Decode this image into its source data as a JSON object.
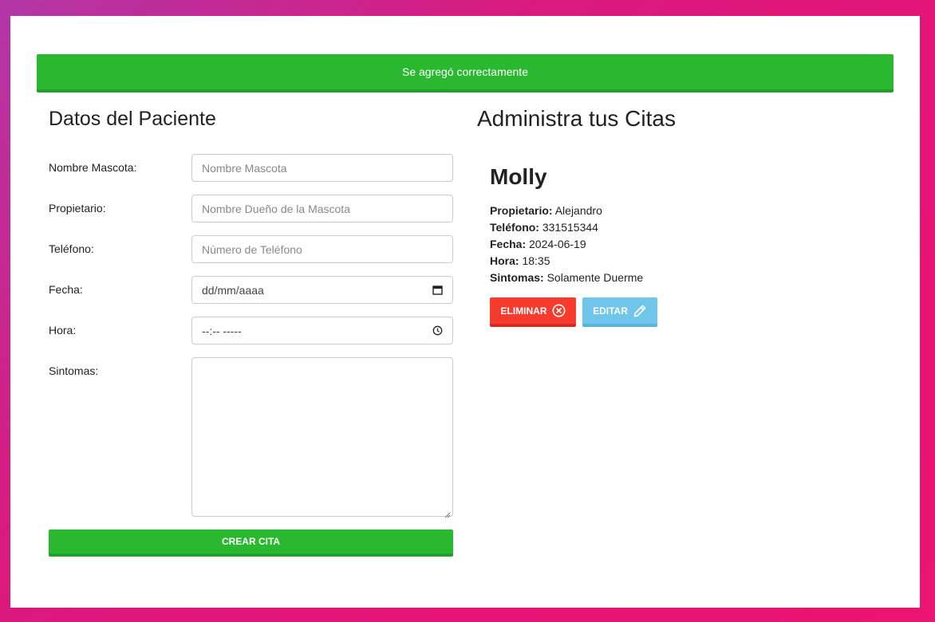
{
  "alert": {
    "message": "Se agregó correctamente"
  },
  "form": {
    "title": "Datos del Paciente",
    "fields": [
      {
        "label": "Nombre Mascota:",
        "placeholder": "Nombre Mascota"
      },
      {
        "label": "Propietario:",
        "placeholder": "Nombre Dueño de la Mascota"
      },
      {
        "label": "Teléfono:",
        "placeholder": "Número de Teléfono"
      },
      {
        "label": "Fecha:",
        "value": "dd/mm/aaaa",
        "icon": "calendar-icon"
      },
      {
        "label": "Hora:",
        "value": "--:-- -----",
        "icon": "clock-icon"
      },
      {
        "label": "Sintomas:",
        "value": ""
      }
    ],
    "submit_label": "CREAR CITA"
  },
  "appointments": {
    "title": "Administra tus Citas",
    "items": [
      {
        "pet_name": "Molly",
        "owner_label": "Propietario:",
        "owner": "Alejandro",
        "phone_label": "Teléfono:",
        "phone": "331515344",
        "date_label": "Fecha:",
        "date": "2024-06-19",
        "time_label": "Hora:",
        "time": "18:35",
        "symptoms_label": "Sintomas:",
        "symptoms": "Solamente Duerme",
        "delete_label": "ELIMINAR",
        "edit_label": "EDITAR"
      }
    ]
  },
  "colors": {
    "success": "#29b82f",
    "danger": "#f83b2f",
    "info": "#6fc6ea",
    "background_gradient": [
      "#b336a6",
      "#ea1471"
    ]
  }
}
